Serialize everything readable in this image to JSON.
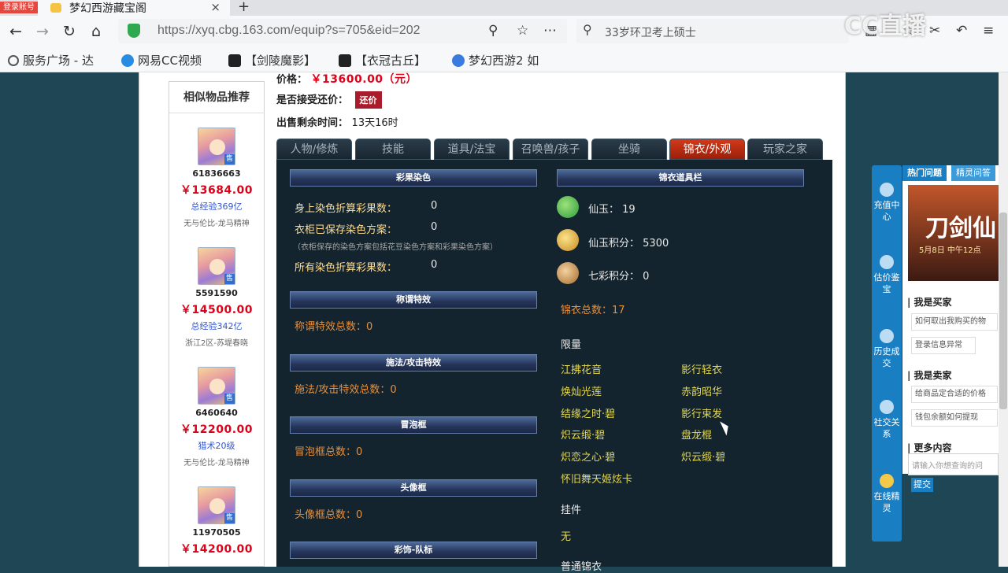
{
  "browser": {
    "login_badge": "登录账号",
    "tab_title": "梦幻西游藏宝阁",
    "tab_close": "×",
    "new_tab": "+",
    "url": "https://xyq.cbg.163.com/equip?s=705&eid=202",
    "search_text": "33岁环卫考上硕士",
    "bookmarks": [
      "服务广场 - 达",
      "网易CC视频",
      "【剑陵魔影】",
      "【衣冠古丘】",
      "梦幻西游2 如"
    ],
    "watermark": "CC直播"
  },
  "sidebar": {
    "title": "相似物品推荐",
    "items": [
      {
        "id": "61836663",
        "price": "￥13684.00",
        "exp": "总经验369亿",
        "server": "无与伦比-龙马精神"
      },
      {
        "id": "5591590",
        "price": "￥14500.00",
        "exp": "总经验342亿",
        "server": "浙江2区-苏堤春晓"
      },
      {
        "id": "6460640",
        "price": "￥12200.00",
        "exp": "猎术20级",
        "server": "无与伦比-龙马精神"
      },
      {
        "id": "11970505",
        "price": "￥14200.00",
        "exp": "",
        "server": ""
      }
    ],
    "sale_tag": "售"
  },
  "info": {
    "price_label": "价格：",
    "price_value": "￥13600.00（元）",
    "haggle_label": "是否接受还价：",
    "haggle_button": "还价",
    "remain_label": "出售剩余时间：",
    "remain_value": "13天16时"
  },
  "tabs": [
    "人物/修炼",
    "技能",
    "道具/法宝",
    "召唤兽/孩子",
    "坐骑",
    "锦衣/外观",
    "玩家之家"
  ],
  "left_panel": {
    "dye_header": "彩果染色",
    "dye_rows": [
      {
        "label": "身上染色折算彩果数：",
        "value": "0"
      },
      {
        "label": "衣柜已保存染色方案：",
        "value": "0"
      }
    ],
    "dye_note": "（衣柜保存的染色方案包括花豆染色方案和彩果染色方案）",
    "dye_total": {
      "label": "所有染色折算彩果数：",
      "value": "0"
    },
    "title_header": "称谓特效",
    "title_total": "称谓特效总数：0",
    "spell_header": "施法/攻击特效",
    "spell_total": "施法/攻击特效总数：0",
    "bubble_header": "冒泡框",
    "bubble_total": "冒泡框总数：0",
    "avatar_header": "头像框",
    "avatar_total": "头像框总数：0",
    "deco_header": "彩饰-队标"
  },
  "right_panel": {
    "header": "锦衣道具栏",
    "currencies": [
      {
        "label": "仙玉：",
        "value": "19",
        "color": "#3fae4a"
      },
      {
        "label": "仙玉积分：",
        "value": "5300",
        "color": "#d6a032"
      },
      {
        "label": "七彩积分：",
        "value": "0",
        "color": "#c8893c"
      }
    ],
    "jinyi_total": "锦衣总数：17",
    "limited_title": "限量",
    "limited_items": [
      "江拂花音",
      "影行轻衣",
      "焕灿光莲",
      "赤韵昭华",
      "结缘之时·碧",
      "影行束发",
      "炽云缎·碧",
      "盘龙棍",
      "炽恋之心·碧",
      "炽云缎·碧",
      "怀旧舞天姬炫卡"
    ],
    "pendant_title": "挂件",
    "pendant_value": "无",
    "normal_title": "普通锦衣"
  },
  "float_bar": {
    "buttons": [
      "充值中心",
      "估价鉴宝",
      "历史成交",
      "社交关系",
      "在线精灵"
    ],
    "panel_tabs": [
      "热门问题",
      "精灵问答"
    ],
    "banner_title": "刀剑仙",
    "banner_sub": "5月8日 中午12点",
    "buyer_title": "| 我是买家",
    "buyer_q": [
      "如何取出我购买的物",
      "登录信息异常"
    ],
    "seller_title": "| 我是卖家",
    "seller_q": [
      "给商品定合适的价格",
      "钱包余额如何提现"
    ],
    "more_title": "| 更多内容",
    "input_placeholder": "请输入你想查询的问",
    "submit": "提交"
  }
}
